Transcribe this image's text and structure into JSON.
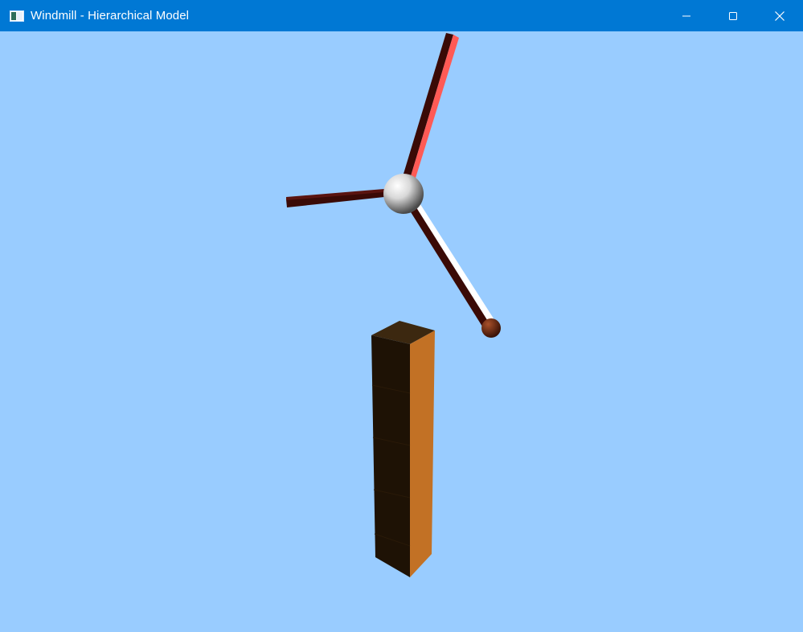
{
  "window": {
    "title": "Windmill - Hierarchical Model",
    "title_bar_color": "#0078d4",
    "title_text_color": "#ffffff",
    "icon": "app-window-icon",
    "controls": {
      "minimize_icon": "minimize-icon",
      "maximize_icon": "maximize-icon",
      "close_icon": "close-icon"
    }
  },
  "scene": {
    "background_color": "#99ccff",
    "objects": [
      "tower",
      "hub",
      "blade-up",
      "blade-left",
      "blade-down-right",
      "blade-tip-ball"
    ],
    "colors": {
      "tower_front": "#1e1205",
      "tower_side": "#c27125",
      "tower_top": "#3c2810",
      "hub": "#d0d0d0",
      "blade_dark": "#3a0a06",
      "blade_highlight_red": "#ff5a55",
      "blade_highlight_white": "#ffffff",
      "tip_ball": "#6b2a14"
    }
  }
}
